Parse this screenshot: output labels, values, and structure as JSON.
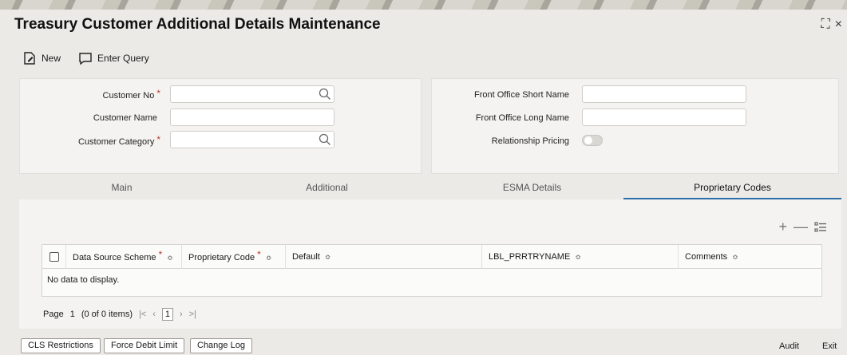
{
  "window": {
    "title": "Treasury Customer Additional Details Maintenance",
    "resize_glyph": "⛶",
    "close_glyph": "×"
  },
  "toolbar": {
    "new_label": "New",
    "enter_query_label": "Enter Query"
  },
  "form": {
    "customer_no": {
      "label": "Customer No",
      "value": "",
      "required": "*"
    },
    "customer_name": {
      "label": "Customer Name",
      "value": ""
    },
    "customer_category": {
      "label": "Customer Category",
      "value": "",
      "required": "*"
    },
    "fo_short_name": {
      "label": "Front Office Short Name",
      "value": ""
    },
    "fo_long_name": {
      "label": "Front Office Long Name",
      "value": ""
    },
    "relationship_pricing": {
      "label": "Relationship Pricing"
    }
  },
  "tabs": [
    {
      "label": "Main"
    },
    {
      "label": "Additional"
    },
    {
      "label": "ESMA Details"
    },
    {
      "label": "Proprietary Codes"
    }
  ],
  "grid": {
    "actions": {
      "add": "+",
      "remove": "—"
    },
    "columns": [
      {
        "label": "Data Source Scheme",
        "required": "*"
      },
      {
        "label": "Proprietary Code",
        "required": "*"
      },
      {
        "label": "Default"
      },
      {
        "label": "LBL_PRRTRYNAME"
      },
      {
        "label": "Comments"
      }
    ],
    "sort_glyph": "≎",
    "empty_text": "No data to display."
  },
  "pager": {
    "page_label": "Page",
    "page_value": "1",
    "items_text": "(0 of 0 items)",
    "first": "|<",
    "prev": "‹",
    "current": "1",
    "next": "›",
    "last": ">|"
  },
  "footer": {
    "cls_restrictions": "CLS Restrictions",
    "force_debit_limit": "Force Debit Limit",
    "change_log": "Change Log",
    "audit": "Audit",
    "exit": "Exit"
  },
  "colors": {
    "accent": "#2e6fa8",
    "required": "#c0392b"
  }
}
